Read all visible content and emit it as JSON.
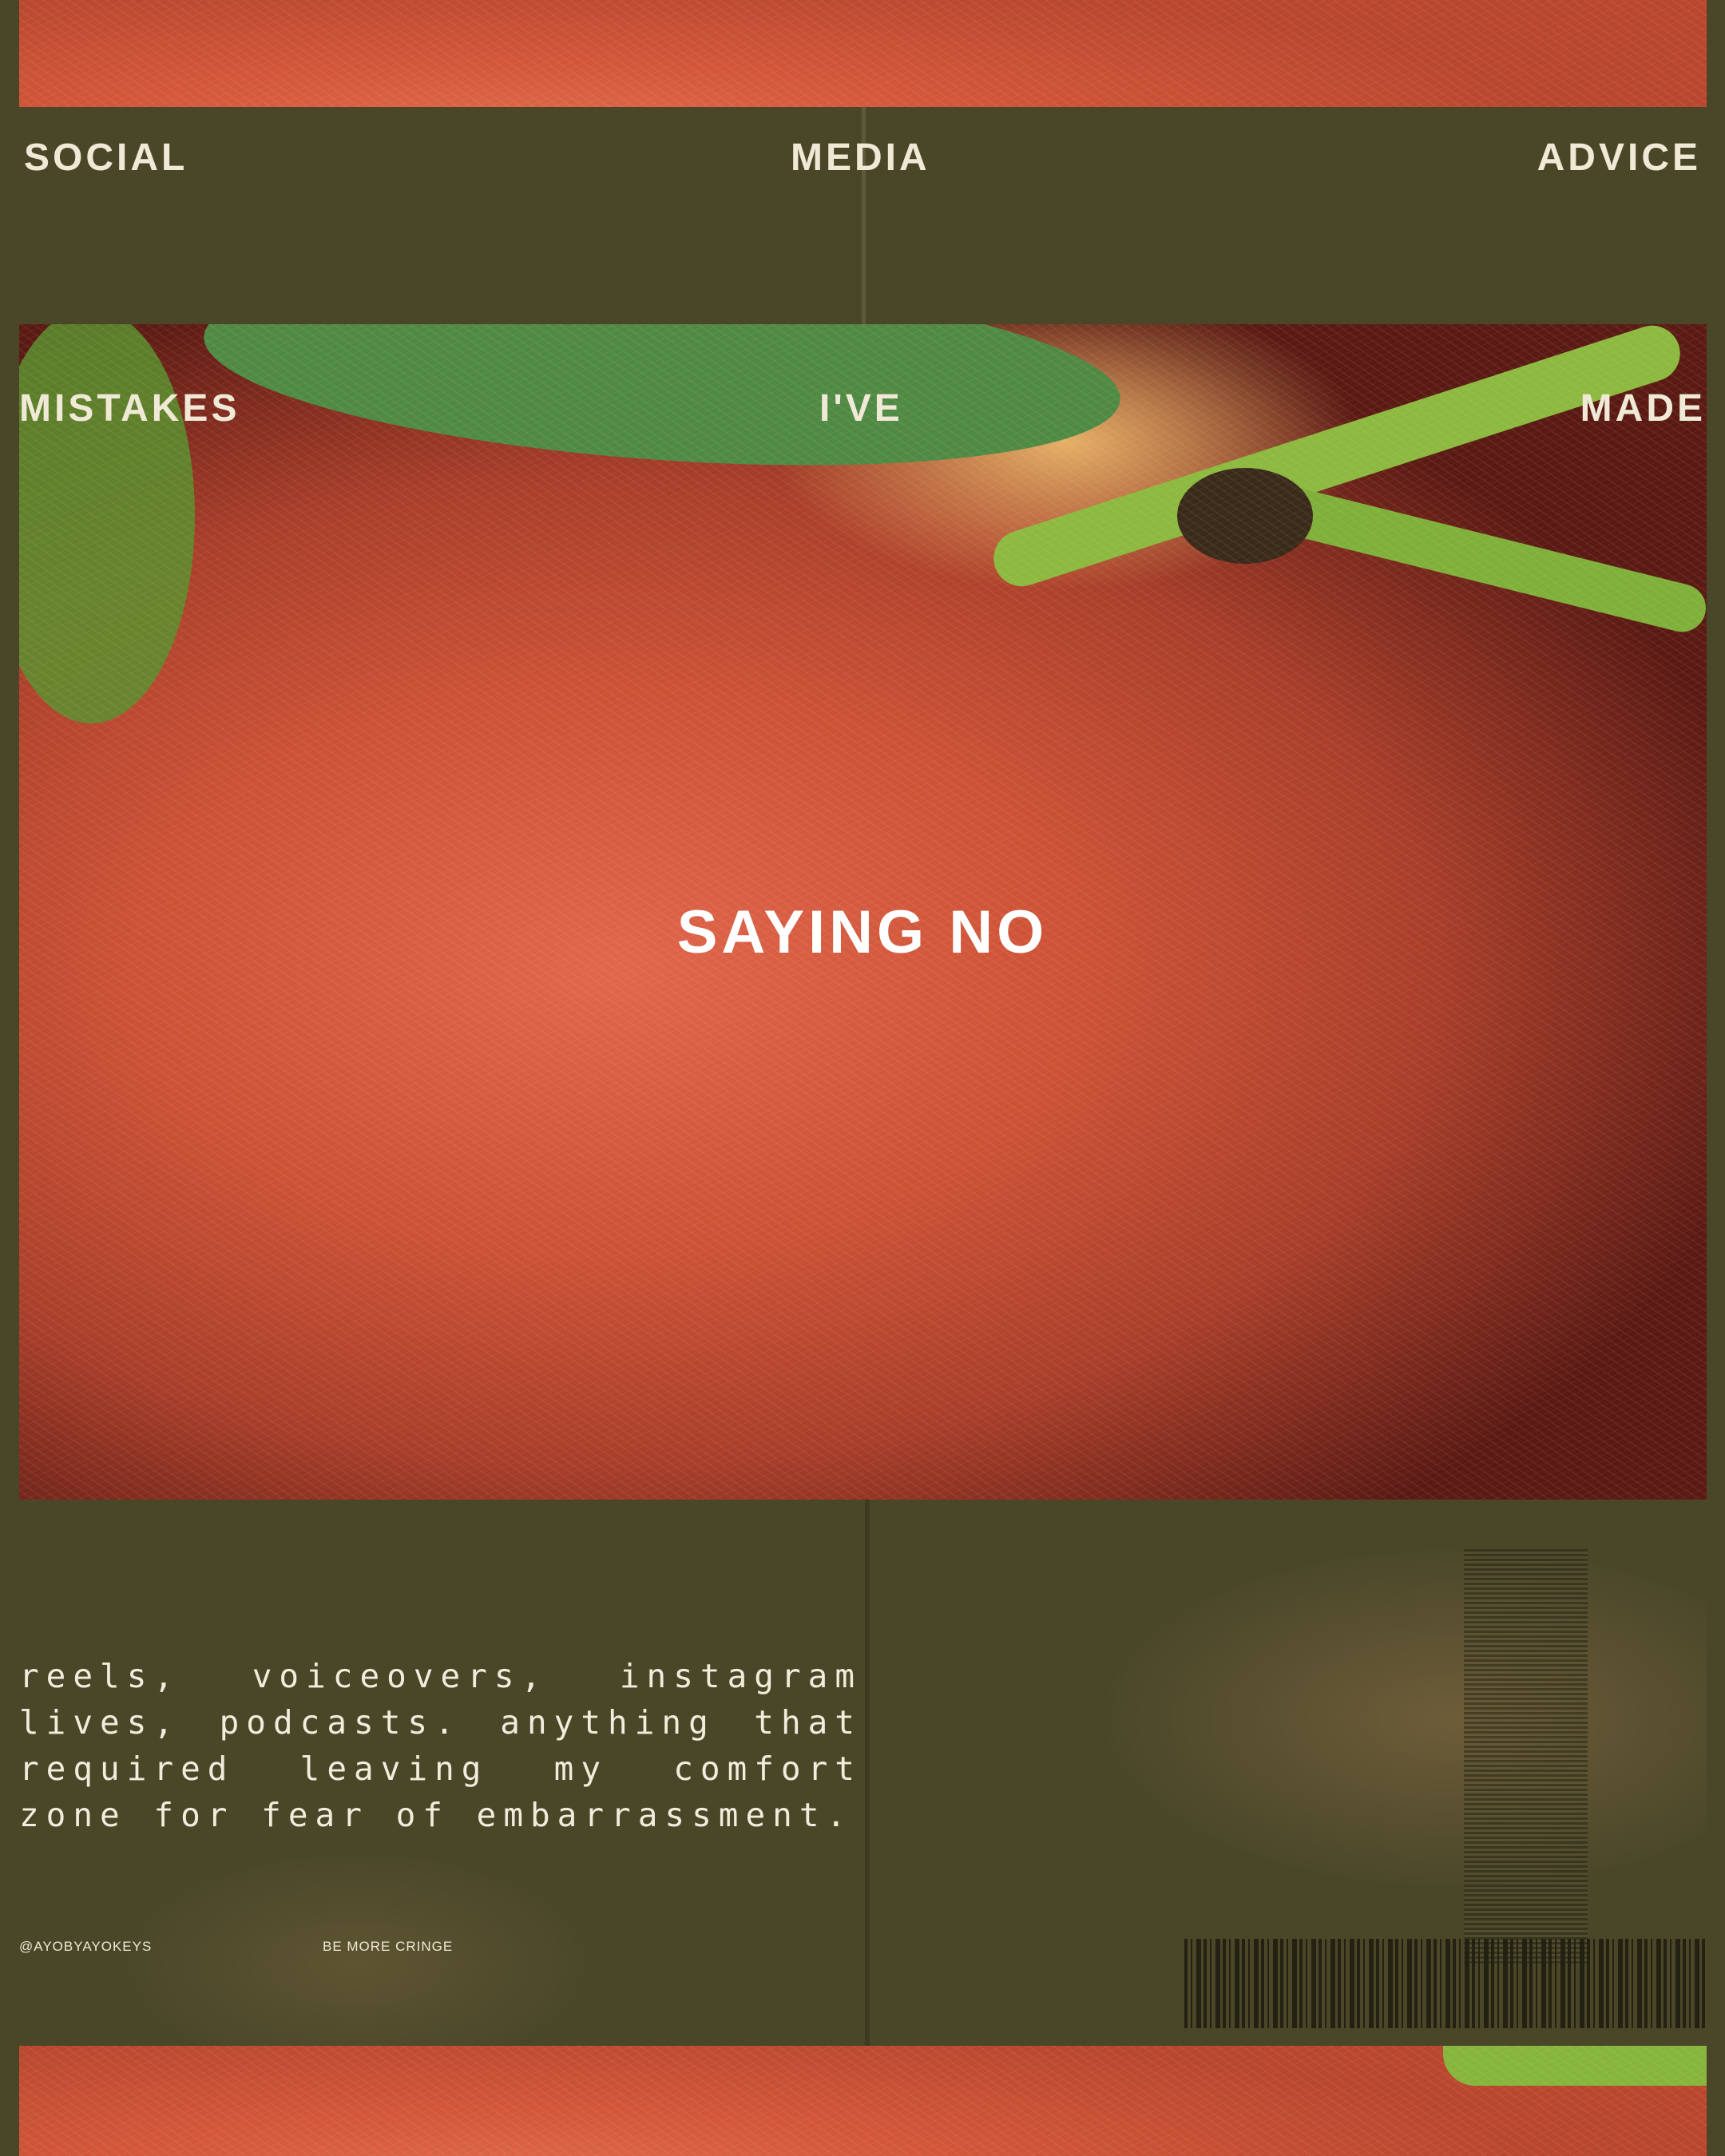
{
  "top_row": {
    "left": "SOCIAL",
    "center": "MEDIA",
    "right": "ADVICE"
  },
  "second_row": {
    "left": "MISTAKES",
    "center": "I'VE",
    "right": "MADE"
  },
  "center_title": "SAYING NO",
  "body_text": "reels, voiceovers, instagram lives, podcasts. anything that required leaving my comfort zone for fear of embarrassment.",
  "footer": {
    "handle": "@AYOBYAYOKEYS",
    "tagline": "BE MORE CRINGE"
  },
  "colors": {
    "background": "#4a4729",
    "text": "#efe9d6",
    "title": "#ffffff"
  },
  "image_subject": "peach"
}
